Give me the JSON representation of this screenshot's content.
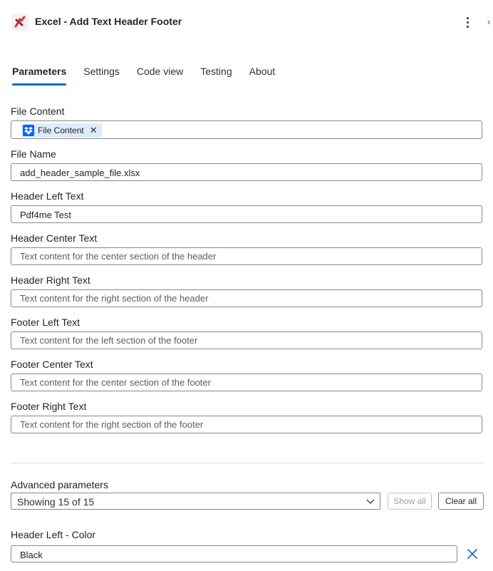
{
  "header": {
    "title": "Excel - Add Text Header Footer",
    "app_icon": "pdf4me-logo-icon",
    "more_icon": "more-vertical-icon",
    "collapse_icon": "chevron-left-icon"
  },
  "tabs": [
    {
      "label": "Parameters",
      "active": true
    },
    {
      "label": "Settings"
    },
    {
      "label": "Code view"
    },
    {
      "label": "Testing"
    },
    {
      "label": "About"
    }
  ],
  "fields": {
    "file_content": {
      "label": "File Content",
      "token": "File Content",
      "token_icon": "dropbox-icon"
    },
    "file_name": {
      "label": "File Name",
      "value": "add_header_sample_file.xlsx"
    },
    "header_left": {
      "label": "Header Left Text",
      "value": "Pdf4me Test"
    },
    "header_center": {
      "label": "Header Center Text",
      "placeholder": "Text content for the center section of the header"
    },
    "header_right": {
      "label": "Header Right Text",
      "placeholder": "Text content for the right section of the header"
    },
    "footer_left": {
      "label": "Footer Left Text",
      "placeholder": "Text content for the left section of the footer"
    },
    "footer_center": {
      "label": "Footer Center Text",
      "placeholder": "Text content for the center section of the footer"
    },
    "footer_right": {
      "label": "Footer Right Text",
      "placeholder": "Text content for the right section of the footer"
    }
  },
  "advanced": {
    "label": "Advanced parameters",
    "selected": "Showing 15 of 15",
    "show_all": "Show all",
    "clear_all": "Clear all"
  },
  "header_left_color": {
    "label": "Header Left - Color",
    "value": "Black"
  },
  "colors": {
    "accent": "#0f6cbd",
    "token_bg": "#deecf9",
    "dropbox": "#0061fe"
  }
}
